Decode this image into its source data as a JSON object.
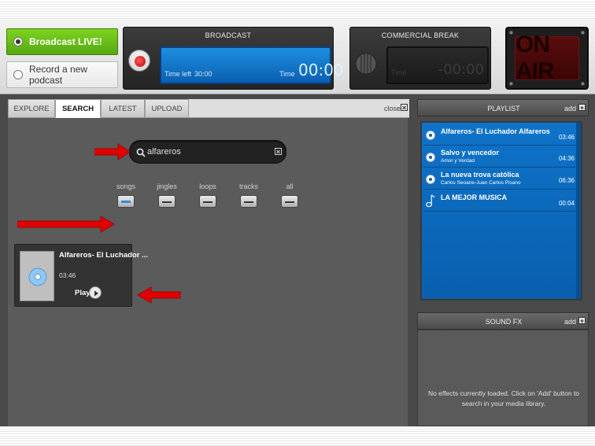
{
  "top": {
    "broadcast_live_label": "Broadcast LIVE!",
    "record_podcast_label": "Record a new podcast",
    "broadcast_panel_title": "BROADCAST",
    "time_left_label": "Time left",
    "time_left_value": "30:00",
    "time_label": "Time",
    "time_value": "00:00",
    "commercial_panel_title": "COMMERCIAL BREAK",
    "commercial_time_label": "Time",
    "commercial_time_value": "-00:00",
    "on_air_label": "ON AIR"
  },
  "tabs": [
    "EXPLORE",
    "SEARCH",
    "LATEST",
    "UPLOAD"
  ],
  "close_label": "close",
  "close_icon_glyph": "×",
  "search": {
    "query": "alfareros",
    "clear_glyph": "×"
  },
  "filters": {
    "songs": "songs",
    "jingles": "jingles",
    "loops": "loops",
    "tracks": "tracks",
    "all": "all",
    "active": "songs"
  },
  "result": {
    "title": "Alfareros- El Luchador ...",
    "duration": "03:46",
    "play_label": "Play"
  },
  "playlist": {
    "title": "PLAYLIST",
    "add_label": "add",
    "items": [
      {
        "title": "Alfareros- El Luchador Alfareros",
        "subtitle": "",
        "duration": "03:46",
        "icon": "cd-icon"
      },
      {
        "title": "Salvo y vencedor",
        "subtitle": "Amor y Verdad",
        "duration": "04:36",
        "icon": "cd-icon"
      },
      {
        "title": "La nueva trova católica",
        "subtitle": "Carlos Seoane-Juan Carlos Pisano",
        "duration": "06:36",
        "icon": "cd-icon"
      },
      {
        "title": "LA MEJOR MUSICA",
        "subtitle": "",
        "duration": "00:04",
        "icon": "music-note-icon"
      }
    ]
  },
  "sound_fx": {
    "title": "SOUND FX",
    "add_label": "add",
    "empty_message_1": "No effects currently loaded. Click on 'Add' button to",
    "empty_message_2": "search in your media library."
  },
  "colors": {
    "live_green": "#6cc21a",
    "lcd_blue": "#1476cf",
    "annotation_red": "#e00000",
    "playlist_blue": "#0c6cc0"
  }
}
